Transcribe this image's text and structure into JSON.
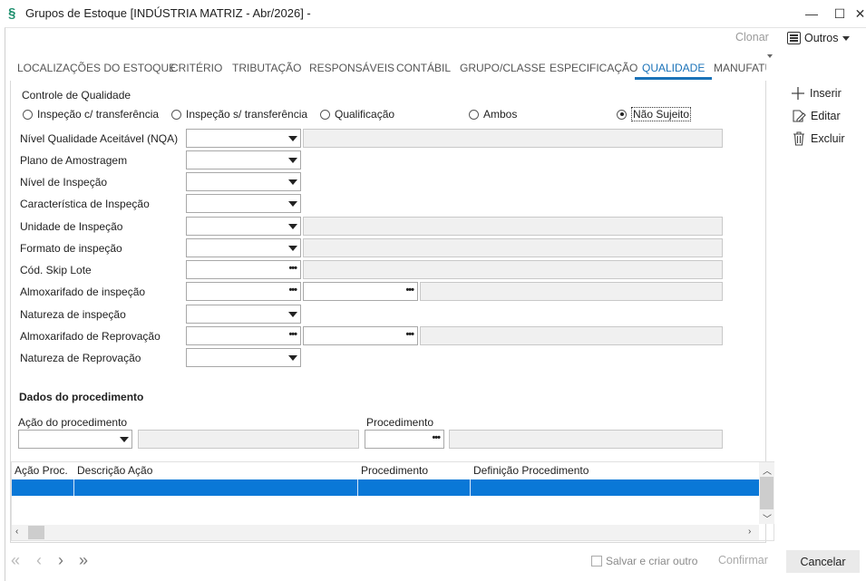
{
  "window": {
    "title": "Grupos de Estoque [INDÚSTRIA MATRIZ - Abr/2026]  -",
    "minimize": "—",
    "maximize": "☐",
    "close": "✕"
  },
  "toolbar": {
    "clonar_label": "Clonar",
    "outros_label": "Outros"
  },
  "tabs": [
    {
      "label": "LOCALIZAÇÕES DO ESTOQUE"
    },
    {
      "label": "CRITÉRIO"
    },
    {
      "label": "TRIBUTAÇÃO"
    },
    {
      "label": "RESPONSÁVEIS"
    },
    {
      "label": "CONTÁBIL"
    },
    {
      "label": "GRUPO/CLASSE"
    },
    {
      "label": "ESPECIFICAÇÃO"
    },
    {
      "label": "QUALIDADE",
      "active": true
    },
    {
      "label": "MANUFATU"
    }
  ],
  "quality": {
    "group_label": "Controle de Qualidade",
    "options": [
      {
        "label": "Inspeção c/ transferência",
        "selected": false
      },
      {
        "label": "Inspeção s/ transferência",
        "selected": false
      },
      {
        "label": "Qualificação",
        "selected": false
      },
      {
        "label": "Ambos",
        "selected": false
      },
      {
        "label": "Não Sujeito",
        "selected": true
      }
    ],
    "fields": {
      "nqa": "Nível Qualidade Aceitável (NQA)",
      "plano": "Plano de Amostragem",
      "nivel": "Nível de Inspeção",
      "caracteristica": "Característica de Inspeção",
      "unidade": "Unidade de Inspeção",
      "formato": "Formato de inspeção",
      "skip": "Cód. Skip Lote",
      "almox_insp": "Almoxarifado de inspeção",
      "natureza_insp": "Natureza de inspeção",
      "almox_reprov": "Almoxarifado de Reprovação",
      "natureza_reprov": "Natureza de Reprovação"
    },
    "lookup_glyph": "•••"
  },
  "procedimento": {
    "section_title": "Dados do procedimento",
    "acao_label": "Ação do procedimento",
    "procedimento_label": "Procedimento"
  },
  "grid": {
    "columns": [
      "Ação Proc.",
      "Descrição Ação",
      "Procedimento",
      "Definição Procedimento"
    ]
  },
  "side_actions": {
    "inserir": "Inserir",
    "editar": "Editar",
    "excluir": "Excluir"
  },
  "footer": {
    "nav_first": "«",
    "nav_prev": "‹",
    "nav_next": "›",
    "nav_last": "»",
    "salvar_label": "Salvar e criar outro",
    "confirmar_label": "Confirmar",
    "cancelar_label": "Cancelar"
  },
  "colors": {
    "accent": "#1a72b8",
    "selection": "#0a78d7",
    "brand_icon": "#1e8f6e"
  }
}
